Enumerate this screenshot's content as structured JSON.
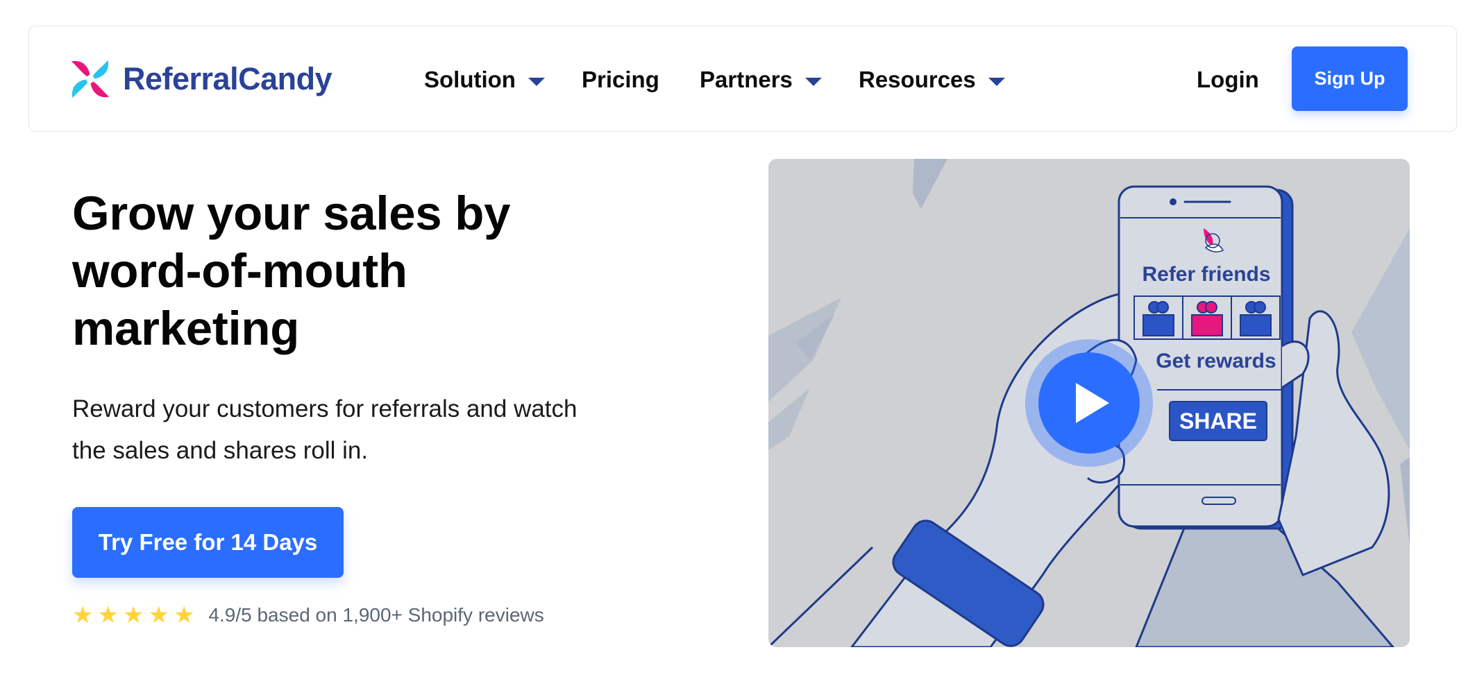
{
  "brand": {
    "name": "ReferralCandy"
  },
  "nav": {
    "items": [
      {
        "label": "Solution",
        "has_dropdown": true
      },
      {
        "label": "Pricing",
        "has_dropdown": false
      },
      {
        "label": "Partners",
        "has_dropdown": true
      },
      {
        "label": "Resources",
        "has_dropdown": true
      }
    ],
    "login_label": "Login",
    "signup_label": "Sign Up"
  },
  "hero": {
    "title_lines": [
      "Grow your sales by",
      "word-of-mouth",
      "marketing"
    ],
    "subtitle_lines": [
      "Reward your customers for referrals and watch",
      "the sales and shares roll in."
    ],
    "cta_label": "Try Free for 14 Days",
    "rating": {
      "stars": 5,
      "text": "4.9/5 based on 1,900+ Shopify reviews"
    }
  },
  "video": {
    "phone_heading": "Refer friends",
    "phone_subheading": "Get rewards",
    "share_label": "SHARE",
    "icon": "play-icon"
  },
  "colors": {
    "brand_blue": "#2b6eff",
    "logo_text": "#2a4398",
    "star": "#ffd43b",
    "video_bg": "#cfd0d3",
    "candy_pink": "#e8177d",
    "candy_cyan": "#27c4ee"
  }
}
